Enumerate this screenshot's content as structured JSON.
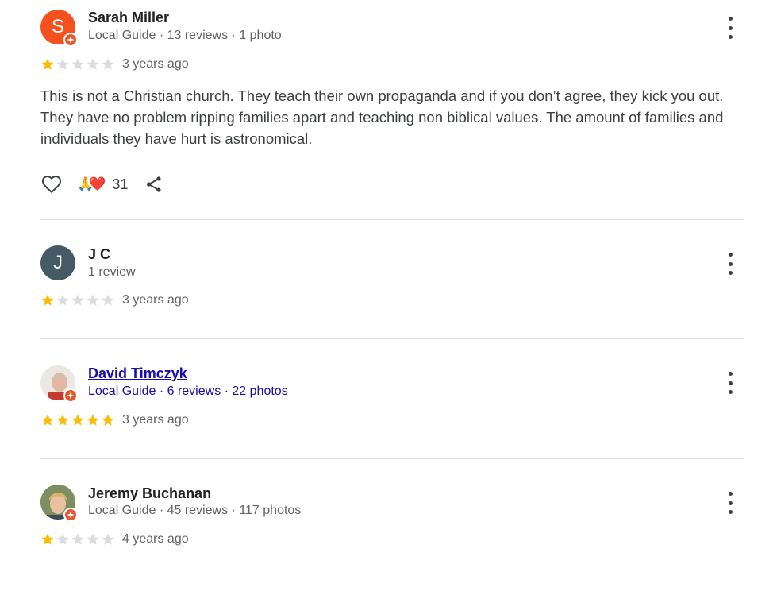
{
  "reviews": [
    {
      "name": "Sarah Miller",
      "initial": "S",
      "avatar_color": "#f4511e",
      "meta": [
        "Local Guide",
        "13 reviews",
        "1 photo"
      ],
      "rating": 1,
      "date": "3 years ago",
      "text": "This is not a Christian church. They teach their own propaganda and if you don’t agree, they kick you out. They have no problem ripping families apart and teaching non biblical values. The amount of families and individuals they have hurt is astronomical.",
      "reactions": "🙏❤️",
      "reaction_count": "31"
    },
    {
      "name": "J C",
      "initial": "J",
      "avatar_color": "#455a64",
      "meta": [
        "1 review"
      ],
      "rating": 1,
      "date": "3 years ago"
    },
    {
      "name": "David Timczyk",
      "meta": [
        "Local Guide",
        "6 reviews",
        "22 photos"
      ],
      "rating": 5,
      "date": "3 years ago"
    },
    {
      "name": "Jeremy Buchanan",
      "meta": [
        "Local Guide",
        "45 reviews",
        "117 photos"
      ],
      "rating": 1,
      "date": "4 years ago"
    }
  ],
  "separator": " · ",
  "colors": {
    "star_filled": "#fbbc04",
    "star_empty": "#dadce0",
    "link": "#1a0dab",
    "guide_badge": "#e8572c"
  },
  "icons": {
    "like": "heart-outline-icon",
    "share": "share-icon",
    "menu": "more-vert-icon",
    "guide": "local-guide-badge-icon"
  }
}
